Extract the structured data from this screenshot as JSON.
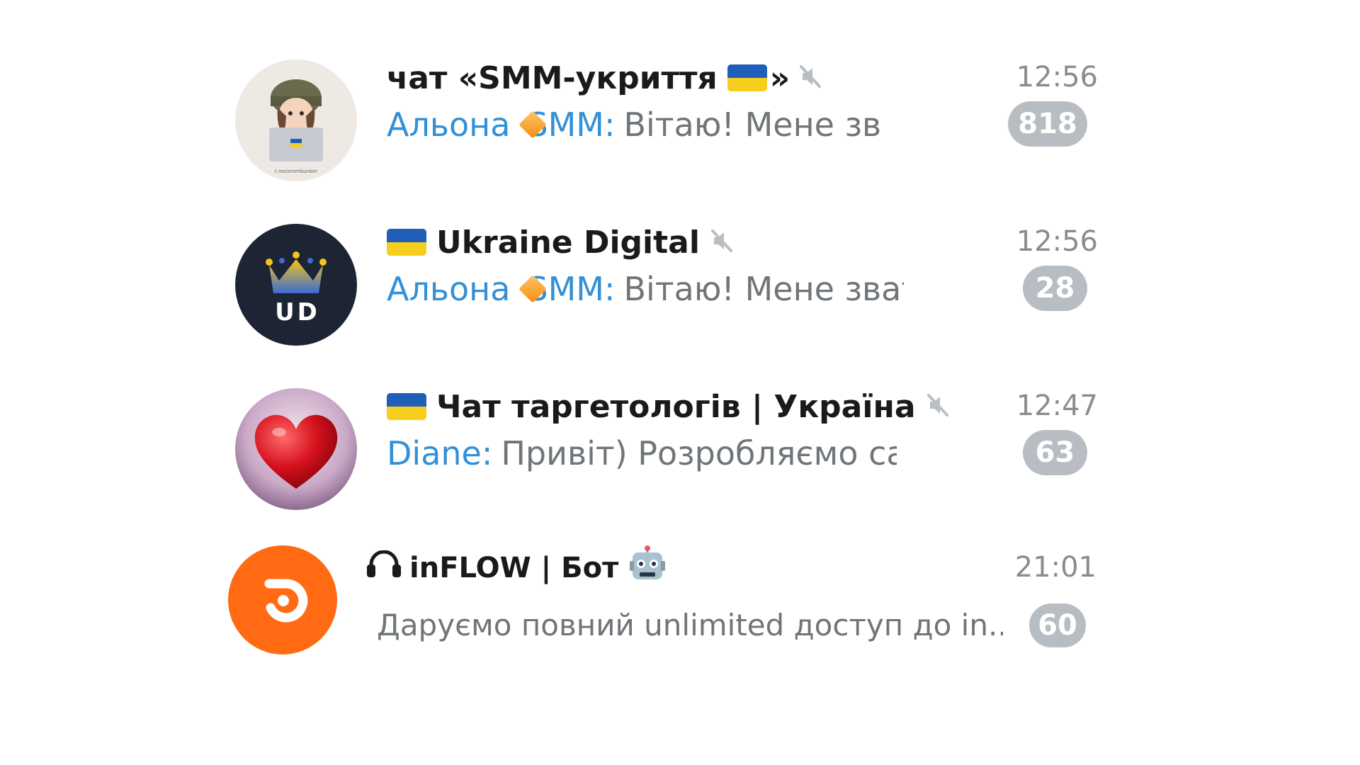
{
  "chats": [
    {
      "title": "чат «SMM-укриття 🇺🇦»",
      "title_prefix": "чат «SMM-укриття",
      "title_suffix": "»",
      "muted": true,
      "time": "12:56",
      "sender": "Альона 🔶 SMM:",
      "sender_name": "Альона",
      "sender_tag": "SMM:",
      "message": "Вітаю! Мене зват...",
      "unread": "818",
      "avatar_caption": "t.me/smmbunker"
    },
    {
      "title": "🇺🇦 Ukraine Digital",
      "title_text": "Ukraine Digital",
      "muted": true,
      "time": "12:56",
      "sender": "Альона 🔶 SMM:",
      "sender_name": "Альона",
      "sender_tag": "SMM:",
      "message": "Вітаю! Мене звати...",
      "unread": "28",
      "avatar_text": "UD"
    },
    {
      "title": "🇺🇦 Чат таргетологів | Україна",
      "title_text": "Чат таргетологів | Україна",
      "muted": true,
      "time": "12:47",
      "sender": "Diane:",
      "message": "Привіт)  Розробляємо сайти...",
      "unread": "63"
    },
    {
      "title": "🎧 inFLOW | Бот 🤖",
      "title_text": "inFLOW | Бот",
      "muted": false,
      "time": "21:01",
      "message": "Даруємо повний unlimited доступ до in...",
      "unread": "60"
    }
  ],
  "icons": {
    "mute": "speaker-muted-icon",
    "flag": "ukraine-flag-icon",
    "diamond": "orange-diamond-icon",
    "robot": "robot-face-icon",
    "headphones": "headphones-icon"
  },
  "colors": {
    "sender": "#3390d6",
    "badge": "#b8bdc3",
    "time": "#8c8c8c",
    "inflow_orange": "#ff6a13"
  }
}
